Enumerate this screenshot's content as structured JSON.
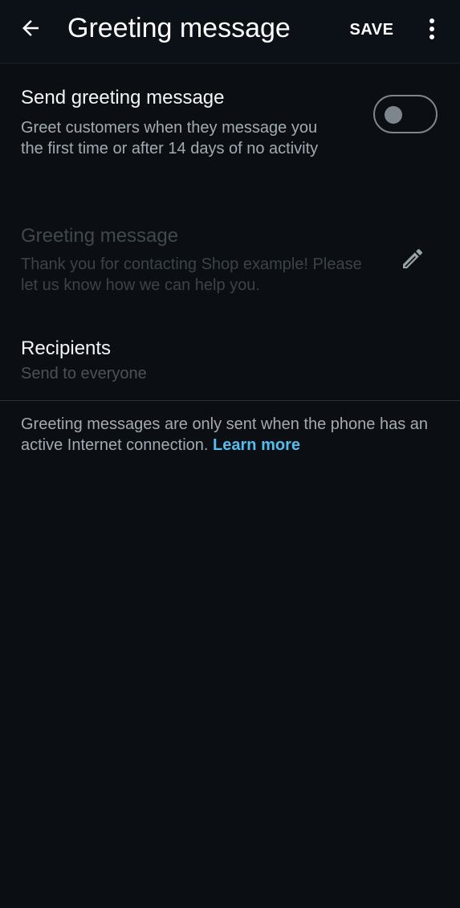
{
  "app_bar": {
    "title": "Greeting message",
    "save_label": "SAVE"
  },
  "send_greeting": {
    "title": "Send greeting message",
    "description": "Greet customers when they message you the first time or after 14 days of no activity",
    "toggle_on": false
  },
  "greeting_message": {
    "title": "Greeting message",
    "text": "Thank you for contacting Shop example! Please let us know how we can help you."
  },
  "recipients": {
    "title": "Recipients",
    "value": "Send to everyone"
  },
  "footer": {
    "note": "Greeting messages are only sent when the phone has an active Internet connection.",
    "learn_more": "Learn more"
  },
  "colors": {
    "background": "#0b0f14",
    "accent": "#53bdeb"
  }
}
